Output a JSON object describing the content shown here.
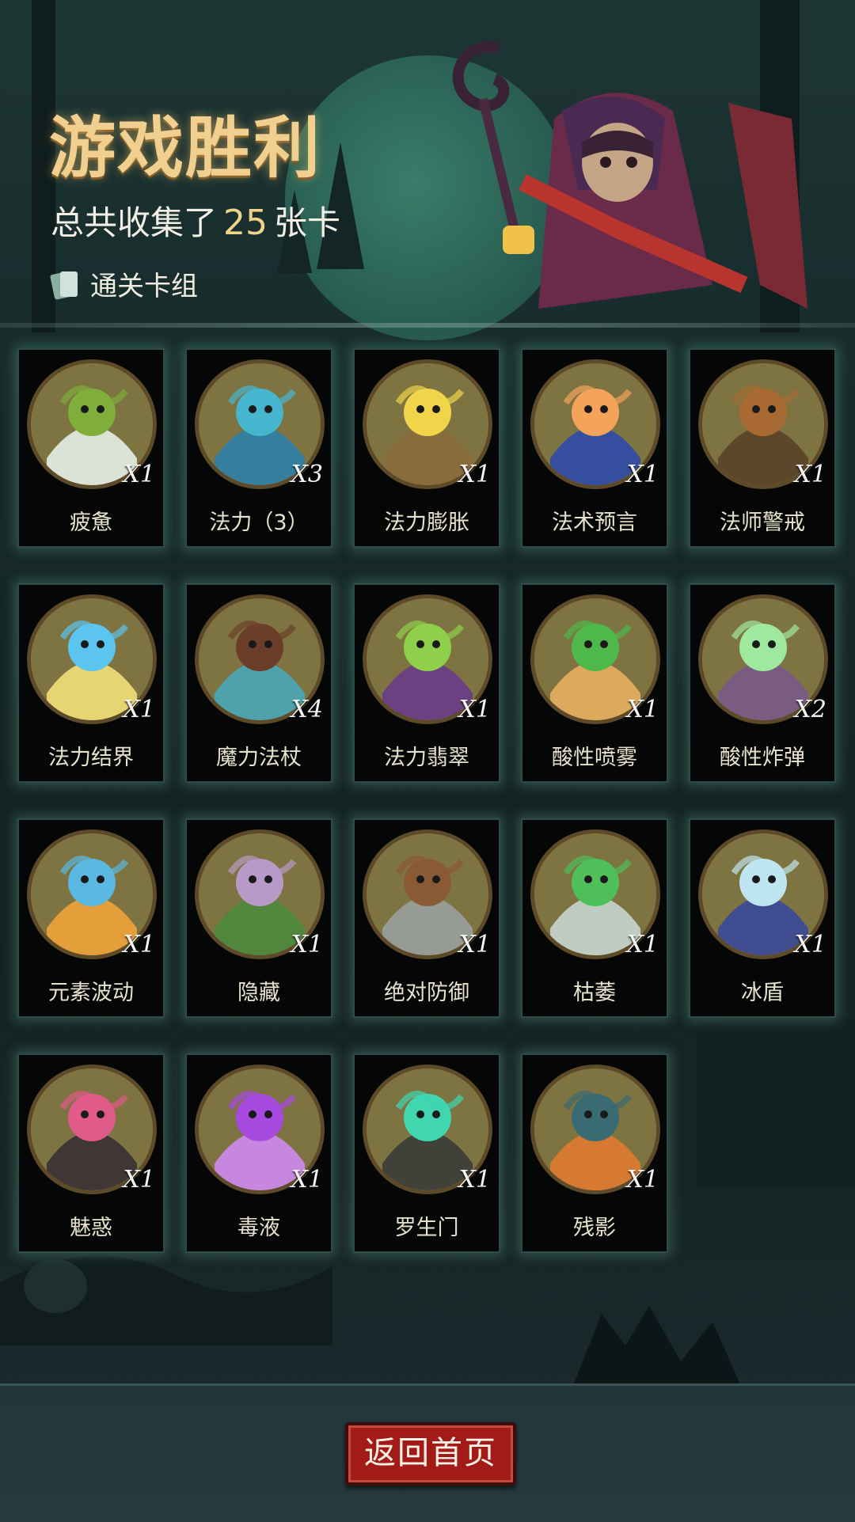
{
  "header": {
    "title": "游戏胜利",
    "subtitle_prefix": "总共收集了",
    "total_cards": "25",
    "subtitle_suffix": "张卡",
    "deck_link_label": "通关卡组",
    "deck_icon": "cards-icon"
  },
  "colors": {
    "title_gold": "#f1cf8f",
    "count_gold": "#f1d389",
    "card_glow": "#60aa96",
    "button_red": "#a31b18"
  },
  "cards": [
    {
      "name": "疲惫",
      "count": "X1",
      "icon": "ghost-ogre-icon",
      "c1": "#7fae3a",
      "c2": "#e6efe8"
    },
    {
      "name": "法力（3）",
      "count": "X3",
      "icon": "mana-orb-icon",
      "c1": "#46b6cf",
      "c2": "#2d7fa8"
    },
    {
      "name": "法力膨胀",
      "count": "X1",
      "icon": "lightning-wizard-icon",
      "c1": "#f0d54a",
      "c2": "#8a6b3c"
    },
    {
      "name": "法术预言",
      "count": "X1",
      "icon": "fire-orb-hands-icon",
      "c1": "#f3a45a",
      "c2": "#2f4aa8"
    },
    {
      "name": "法师警戒",
      "count": "X1",
      "icon": "hooded-mage-icon",
      "c1": "#a86a32",
      "c2": "#5a4228"
    },
    {
      "name": "法力结界",
      "count": "X1",
      "icon": "barrier-hand-icon",
      "c1": "#5bc4ef",
      "c2": "#f3e07a"
    },
    {
      "name": "魔力法杖",
      "count": "X4",
      "icon": "staff-icon",
      "c1": "#6b3e2a",
      "c2": "#4aa6b8"
    },
    {
      "name": "法力翡翠",
      "count": "X1",
      "icon": "emerald-icon",
      "c1": "#8fd04a",
      "c2": "#6a3c8a"
    },
    {
      "name": "酸性喷雾",
      "count": "X1",
      "icon": "acid-spray-icon",
      "c1": "#4fb84a",
      "c2": "#e8b060"
    },
    {
      "name": "酸性炸弹",
      "count": "X2",
      "icon": "acid-bomb-icon",
      "c1": "#9ee8a0",
      "c2": "#7a5a8a"
    },
    {
      "name": "元素波动",
      "count": "X1",
      "icon": "elemental-wave-icon",
      "c1": "#5bb8e0",
      "c2": "#f0a33a"
    },
    {
      "name": "隐藏",
      "count": "X1",
      "icon": "hiding-imp-icon",
      "c1": "#b89ac8",
      "c2": "#4d8a3c"
    },
    {
      "name": "绝对防御",
      "count": "X1",
      "icon": "shield-dwarf-icon",
      "c1": "#8a5a34",
      "c2": "#9aa0a0"
    },
    {
      "name": "枯萎",
      "count": "X1",
      "icon": "withered-ghoul-icon",
      "c1": "#4fbf5a",
      "c2": "#c8d6d0"
    },
    {
      "name": "冰盾",
      "count": "X1",
      "icon": "ice-wizard-icon",
      "c1": "#bfe6f0",
      "c2": "#3a4a9a"
    },
    {
      "name": "魅惑",
      "count": "X1",
      "icon": "charmed-rogue-icon",
      "c1": "#e05a8a",
      "c2": "#3a3034"
    },
    {
      "name": "毒液",
      "count": "X1",
      "icon": "venom-splash-icon",
      "c1": "#a64ae0",
      "c2": "#d08af0"
    },
    {
      "name": "罗生门",
      "count": "X1",
      "icon": "demon-gate-icon",
      "c1": "#3fd6b0",
      "c2": "#3a3d3a"
    },
    {
      "name": "残影",
      "count": "X1",
      "icon": "shadow-clones-icon",
      "c1": "#3a6a72",
      "c2": "#e07a30"
    }
  ],
  "footer": {
    "home_button_label": "返回首页"
  }
}
